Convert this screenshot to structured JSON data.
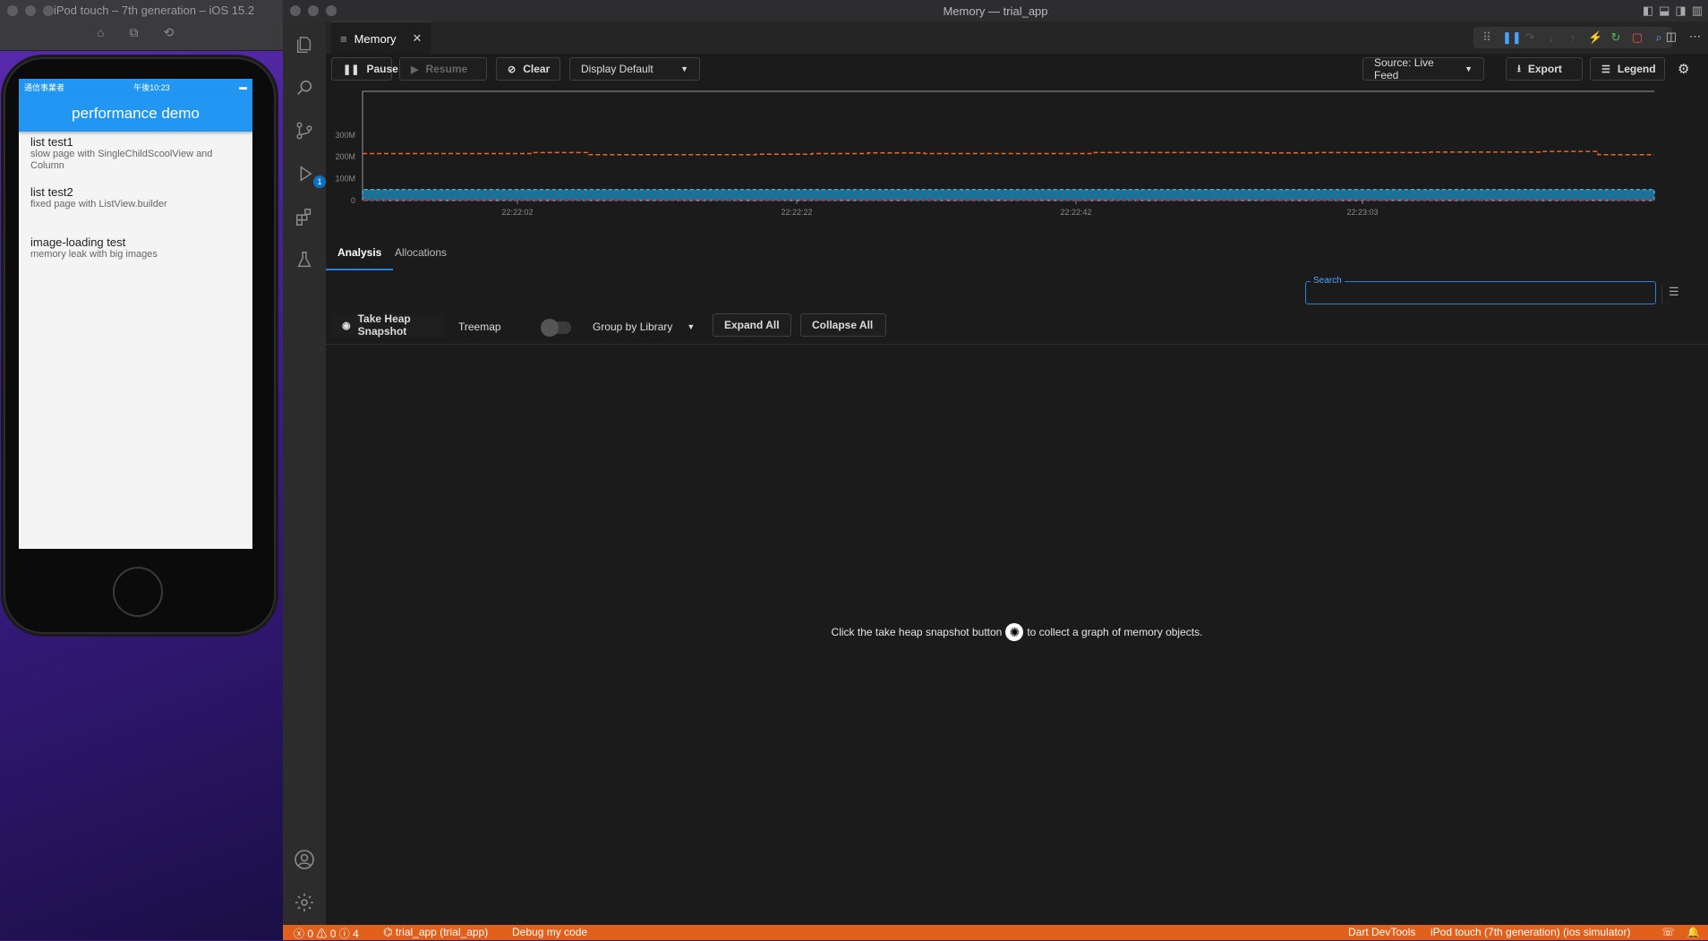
{
  "simulator": {
    "title": "iPod touch – 7th generation – iOS 15.2",
    "status_left": "通信事業者",
    "status_time": "午後10:23",
    "app_title": "performance demo",
    "items": [
      {
        "title": "list test1",
        "subtitle": "slow page with SingleChildScoolView and Column"
      },
      {
        "title": "list test2",
        "subtitle": "fixed page with ListView.builder"
      },
      {
        "title": "image-loading test",
        "subtitle": "memory leak with big images"
      }
    ]
  },
  "window": {
    "title": "Memory — trial_app"
  },
  "activity_bar": {
    "debug_badge": "1"
  },
  "tab": {
    "label": "Memory"
  },
  "toolbar": {
    "pause": "Pause",
    "resume": "Resume",
    "clear": "Clear",
    "display": "Display Default",
    "source": "Source: Live Feed",
    "export": "Export",
    "legend": "Legend"
  },
  "chart_data": {
    "type": "area",
    "ylabels": [
      "300M",
      "200M",
      "100M",
      "0"
    ],
    "yvalues": [
      300,
      200,
      100,
      0
    ],
    "xlabels": [
      "22:22:02",
      "22:22:22",
      "22:22:42",
      "22:23:03"
    ],
    "series": [
      {
        "color": "#e8672a",
        "values": [
          215,
          215,
          215,
          220,
          210,
          210,
          210,
          212,
          215,
          218,
          215,
          215,
          215,
          220,
          220,
          220,
          218,
          220,
          220,
          222,
          222,
          225,
          210,
          210
        ]
      },
      {
        "color": "#1e8fc0",
        "values": [
          50,
          50,
          50,
          50,
          50,
          50,
          50,
          50,
          50,
          50,
          50,
          50,
          50,
          50,
          50,
          50,
          50,
          50,
          50,
          50,
          50,
          50,
          50,
          50
        ]
      },
      {
        "color": "#d02030",
        "values": [
          2,
          2,
          2,
          2,
          2,
          2,
          2,
          2,
          2,
          2,
          2,
          2,
          2,
          2,
          2,
          2,
          2,
          2,
          2,
          2,
          2,
          2,
          2,
          2
        ]
      }
    ],
    "ylim": [
      0,
      500
    ]
  },
  "analysis": {
    "tab_analysis": "Analysis",
    "tab_allocations": "Allocations",
    "search_label": "Search",
    "search_value": "",
    "take_snapshot": "Take Heap Snapshot",
    "treemap": "Treemap",
    "group_by": "Group by Library",
    "expand_all": "Expand All",
    "collapse_all": "Collapse All",
    "empty_before": "Click the take heap snapshot button",
    "empty_after": "to collect a graph of memory objects."
  },
  "statusbar": {
    "problems": "0",
    "warnings": "0",
    "infos": "4",
    "app": "trial_app (trial_app)",
    "debug": "Debug my code",
    "devtools": "Dart DevTools",
    "device": "iPod touch (7th generation) (ios simulator)"
  }
}
